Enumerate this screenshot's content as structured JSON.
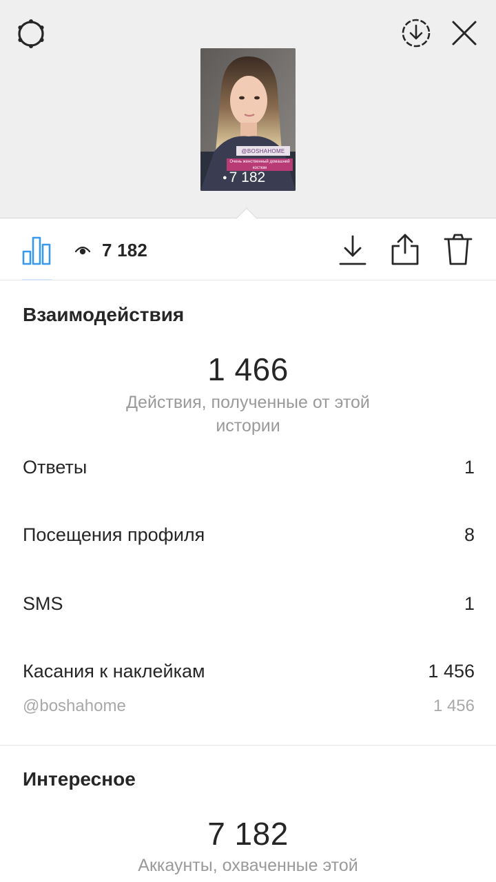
{
  "header": {
    "icons": [
      "settings-icon",
      "download-circle-icon",
      "close-icon"
    ]
  },
  "story": {
    "tag": "@BOSHAHOME",
    "caption": "Очень женственный домашний костюм",
    "views": "7 182"
  },
  "toolbar": {
    "views_count": "7 182",
    "icons": [
      "bar-chart-icon",
      "eye-icon",
      "download-icon",
      "share-icon",
      "trash-icon"
    ],
    "accent_color": "#3897f0"
  },
  "interactions": {
    "title": "Взаимодействия",
    "total": "1 466",
    "caption": "Действия, полученные от этой истории",
    "rows": [
      {
        "label": "Ответы",
        "value": "1"
      },
      {
        "label": "Посещения профиля",
        "value": "8"
      },
      {
        "label": "SMS",
        "value": "1"
      },
      {
        "label": "Касания к наклейкам",
        "value": "1 456"
      }
    ],
    "sub_row": {
      "label": "@boshahome",
      "value": "1 456"
    }
  },
  "discovery": {
    "title": "Интересное",
    "total": "7 182",
    "caption": "Аккаунты, охваченные этой"
  }
}
